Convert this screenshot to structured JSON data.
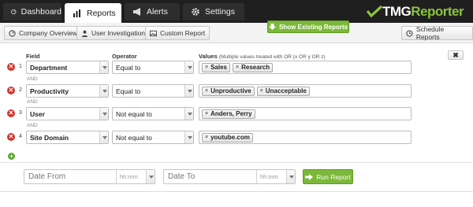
{
  "nav": {
    "tabs": [
      {
        "label": "Dashboard",
        "icon": "dashboard-gauge-icon"
      },
      {
        "label": "Reports",
        "icon": "bar-chart-icon"
      },
      {
        "label": "Alerts",
        "icon": "megaphone-icon"
      },
      {
        "label": "Settings",
        "icon": "gear-icon"
      }
    ],
    "active_tab": "Reports",
    "logo": {
      "part1": "TMG",
      "part2": "Reporter"
    }
  },
  "toolbar": {
    "company_overview": "Company Overview",
    "user_investigation": "User Investigation",
    "custom_report": "Custom Report",
    "show_existing": "Show Existing Reports",
    "schedule_reports": "Schedule Reports"
  },
  "form": {
    "headers": {
      "field": "Field",
      "operator": "Operator",
      "values": "Values",
      "values_hint": "(Multiple values treated with OR (x OR y OR z)"
    },
    "and_label": "AND",
    "rows": [
      {
        "num": "1",
        "field": "Department",
        "operator": "Equal to",
        "values": [
          "Sales",
          "Research"
        ]
      },
      {
        "num": "2",
        "field": "Productivity",
        "operator": "Equal to",
        "values": [
          "Unproductive",
          "Unacceptable"
        ]
      },
      {
        "num": "3",
        "field": "User",
        "operator": "Not equal to",
        "values": [
          "Anders, Perry"
        ]
      },
      {
        "num": "4",
        "field": "Site Domain",
        "operator": "Not equal to",
        "values": [
          "youtube.com"
        ]
      }
    ],
    "close_symbol": "✖",
    "remove_symbol": "✕",
    "add_symbol": "+",
    "chip_remove": "×"
  },
  "date": {
    "from_placeholder": "Date From",
    "to_placeholder": "Date To",
    "time_placeholder": "hh:mm",
    "run_label": "Run Report"
  },
  "colors": {
    "accent_green": "#7cb83a",
    "remove_red": "#d6322c",
    "nav_bg": "#1f1f1f"
  }
}
